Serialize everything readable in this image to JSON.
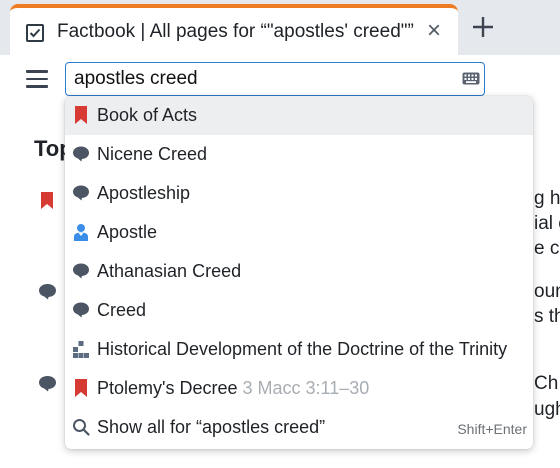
{
  "tab": {
    "title": "Factbook | All pages for “\"apostles' creed\"”",
    "close_glyph": "×",
    "favicon": "checkbox-icon",
    "accent": "#ef7b22"
  },
  "toolbar": {
    "menu_icon": "hamburger-menu-icon",
    "search": {
      "value": "apostles creed",
      "keyboard_icon": "keyboard-icon",
      "border_color": "#2b7cd3"
    }
  },
  "page": {
    "heading": "Top",
    "fragments": [
      "g h",
      "ial e",
      "e ch",
      "ounc",
      "s th",
      "Ch",
      "ugh"
    ]
  },
  "suggestions": [
    {
      "icon": "bookmark-icon",
      "label": "Book of Acts",
      "active": true
    },
    {
      "icon": "speech-bubble-icon",
      "label": "Nicene Creed"
    },
    {
      "icon": "speech-bubble-icon",
      "label": "Apostleship"
    },
    {
      "icon": "person-icon",
      "label": "Apostle"
    },
    {
      "icon": "speech-bubble-icon",
      "label": "Athanasian Creed"
    },
    {
      "icon": "speech-bubble-icon",
      "label": "Creed"
    },
    {
      "icon": "hierarchy-icon",
      "label": "Historical Development of the Doctrine of the Trinity"
    },
    {
      "icon": "bookmark-icon",
      "label": "Ptolemy's Decree",
      "reference": "3 Macc 3:11–30"
    },
    {
      "icon": "search-icon",
      "label": "Show all for “apostles creed”",
      "shortcut": "Shift+Enter"
    }
  ],
  "colors": {
    "bookmark": "#d63a32",
    "bubble": "#4b5563",
    "person": "#3b8ee8",
    "hierarchy": "#5b6b80",
    "active_row": "#eceeef"
  }
}
